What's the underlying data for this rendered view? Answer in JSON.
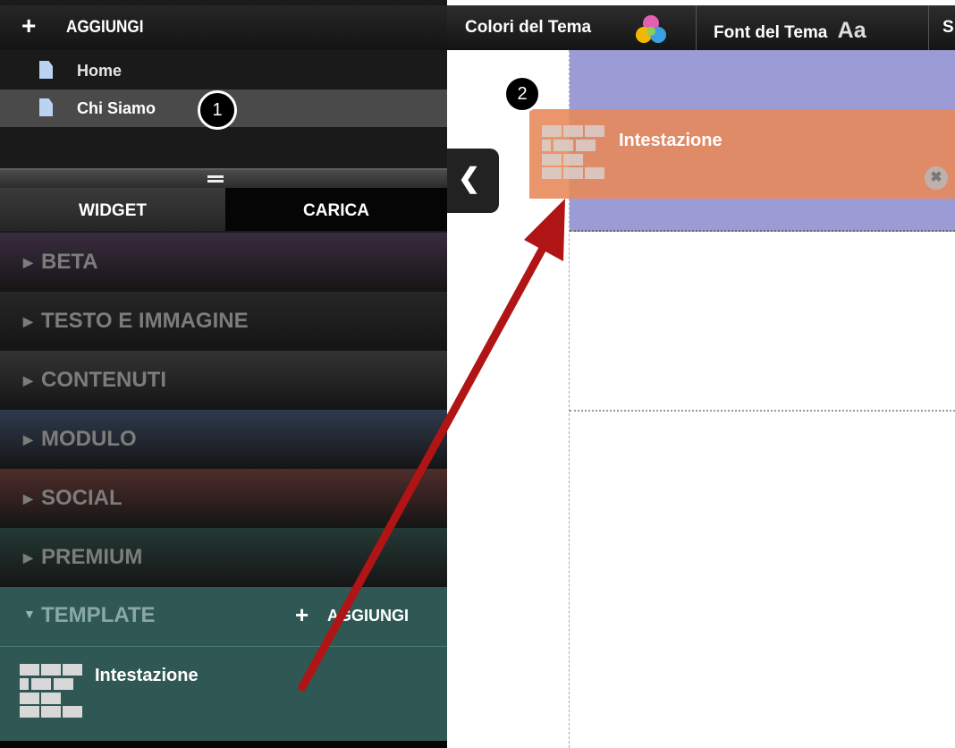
{
  "sidebar": {
    "add_label": "AGGIUNGI",
    "pages": [
      {
        "label": "Home",
        "selected": false
      },
      {
        "label": "Chi Siamo",
        "selected": true
      }
    ],
    "tabs": {
      "widget": "WIDGET",
      "upload": "CARICA"
    },
    "categories": [
      {
        "label": "BETA",
        "color": "#3a2c40"
      },
      {
        "label": "TESTO E IMMAGINE",
        "color": "#262626"
      },
      {
        "label": "CONTENUTI",
        "color": "#333333"
      },
      {
        "label": "MODULO",
        "color": "#2f3a4d"
      },
      {
        "label": "SOCIAL",
        "color": "#4e2d2a"
      },
      {
        "label": "PREMIUM",
        "color": "#243a35"
      }
    ],
    "template": {
      "label": "TEMPLATE",
      "add_label": "AGGIUNGI",
      "color": "#2f5854",
      "item_label": "Intestazione"
    }
  },
  "toolbar": {
    "theme_colors": "Colori del Tema",
    "theme_fonts": "Font del Tema",
    "fonts_glyph": "Aa",
    "cut_label": "S"
  },
  "canvas": {
    "dragged_widget_label": "Intestazione",
    "header_color": "#9b9bd5",
    "widget_color": "#e88a5c"
  },
  "annotations": {
    "step1": "1",
    "step2": "2",
    "arrow_color": "#b01414"
  }
}
